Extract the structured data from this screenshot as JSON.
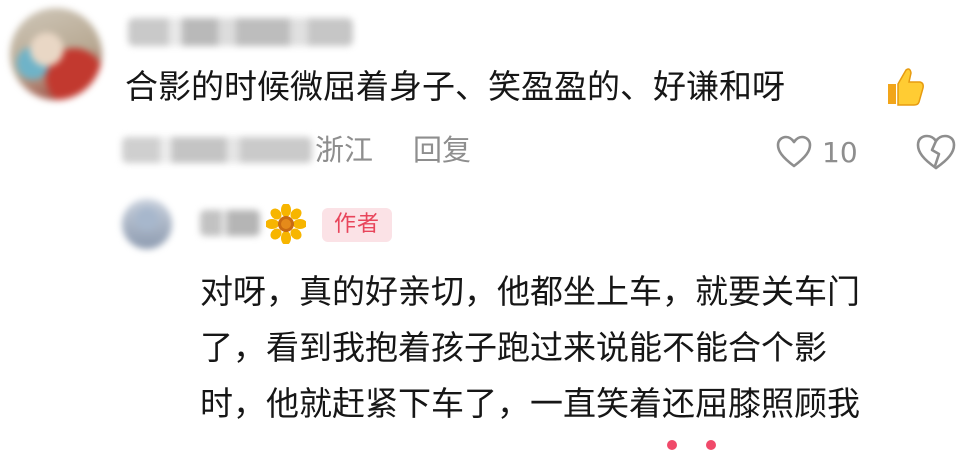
{
  "comment": {
    "username": "",
    "text": "合影的时候微屈着身子、笑盈盈的、好谦和呀",
    "emoji": "thumbs-up-icon",
    "timestamp": "",
    "region": "浙江",
    "reply_label": "回复",
    "like_count": "10"
  },
  "reply": {
    "username": "",
    "badge": "作者",
    "lines": [
      "对呀，真的好亲切，他都坐上车，就要关车门",
      "了，看到我抱着孩子跑过来说能不能合个影",
      "时，他就赶紧下车了，一直笑着还屈膝照顾我"
    ]
  },
  "colors": {
    "meta_gray": "#8e8e8e",
    "author_badge_text": "#e8455b",
    "author_badge_bg": "#fbe2e6"
  }
}
